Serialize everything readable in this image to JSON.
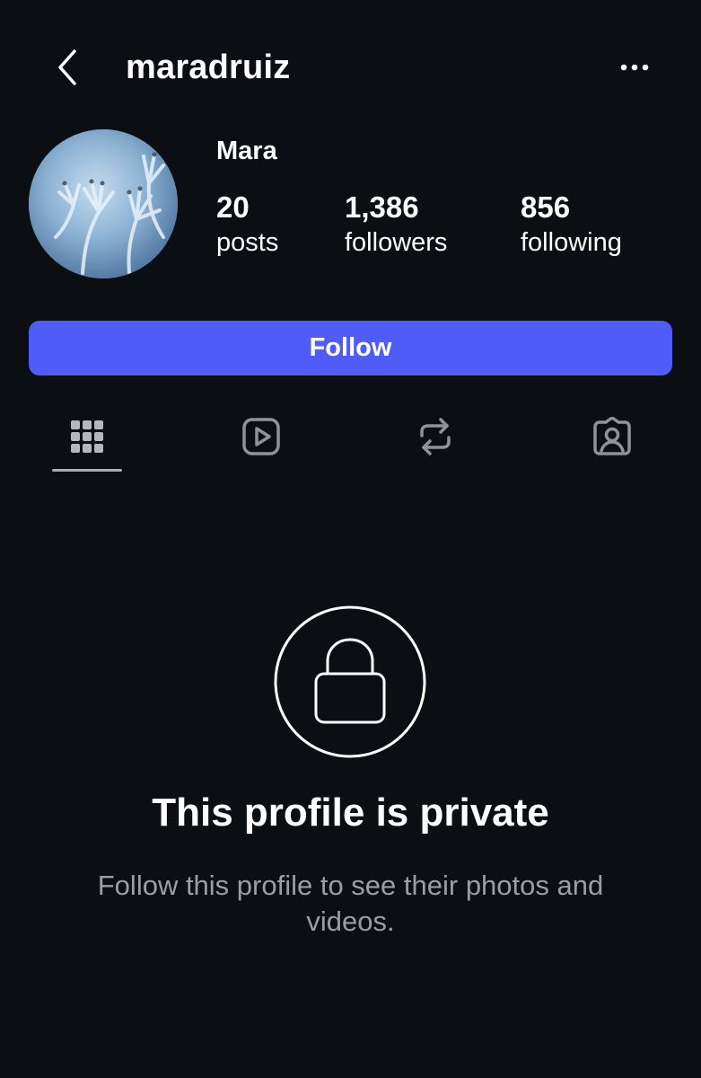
{
  "header": {
    "username": "maradruiz",
    "back_icon": "chevron-left-icon",
    "more_icon": "more-horizontal-icon"
  },
  "profile": {
    "display_name": "Mara",
    "avatar": "profile-photo-hands",
    "stats": [
      {
        "value": "20",
        "label": "posts"
      },
      {
        "value": "1,386",
        "label": "followers"
      },
      {
        "value": "856",
        "label": "following"
      }
    ]
  },
  "actions": {
    "follow_label": "Follow",
    "follow_color": "#4f5cf8"
  },
  "tabs": [
    {
      "icon": "grid-icon",
      "active": true
    },
    {
      "icon": "reels-icon",
      "active": false
    },
    {
      "icon": "reposts-icon",
      "active": false
    },
    {
      "icon": "tagged-icon",
      "active": false
    }
  ],
  "private_notice": {
    "icon": "lock-icon",
    "title": "This profile is private",
    "subtitle": "Follow this profile to see their photos and videos."
  },
  "colors": {
    "background": "#0b0f14",
    "text": "#ffffff",
    "muted_text": "#9a9ea5",
    "tab_icon": "#8e9399"
  }
}
